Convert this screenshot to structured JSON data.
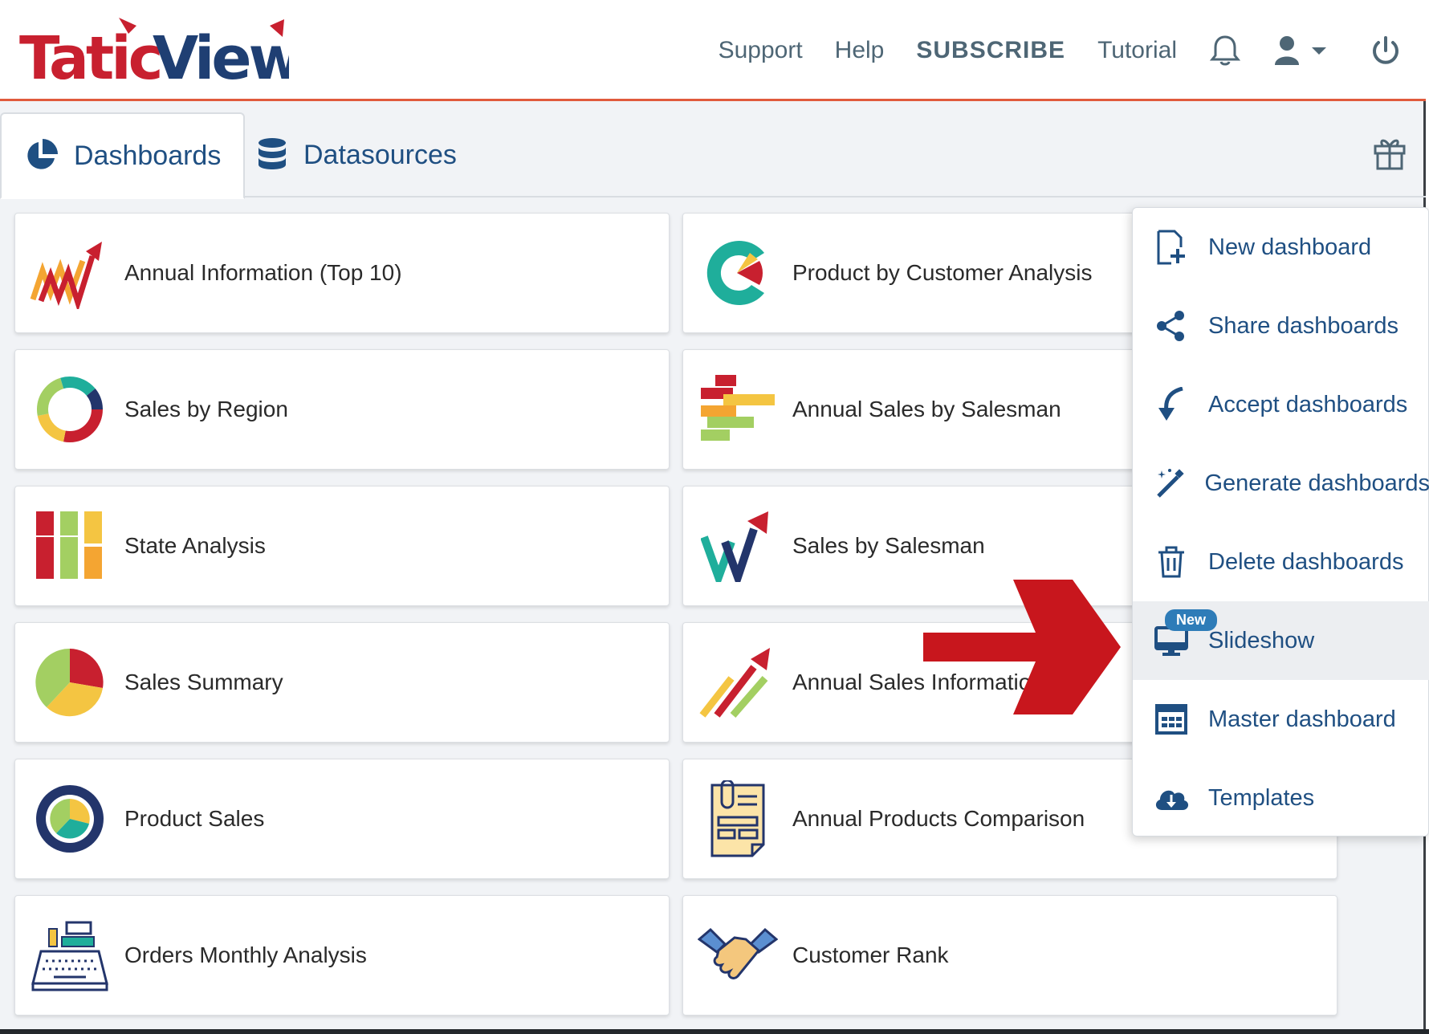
{
  "brand": {
    "logo_text": "TaticView",
    "accent": "#e05a3c",
    "primary": "#1f4f82"
  },
  "header": {
    "nav": [
      {
        "label": "Support"
      },
      {
        "label": "Help"
      },
      {
        "label": "SUBSCRIBE"
      },
      {
        "label": "Tutorial"
      }
    ],
    "icons": [
      "bell-icon",
      "user-icon",
      "chevron-down-icon",
      "power-icon"
    ]
  },
  "tabs": [
    {
      "label": "Dashboards",
      "icon": "pie-chart-icon",
      "active": true
    },
    {
      "label": "Datasources",
      "icon": "database-icon",
      "active": false
    }
  ],
  "dashboards": [
    {
      "label": "Annual Information (Top 10)",
      "icon": "trend-arrow-icon"
    },
    {
      "label": "Product by Customer Analysis",
      "icon": "c-pie-icon"
    },
    {
      "label": "Sales by Region",
      "icon": "donut-icon"
    },
    {
      "label": "Annual Sales by Salesman",
      "icon": "horizontal-bars-icon"
    },
    {
      "label": "State Analysis",
      "icon": "stacked-columns-icon"
    },
    {
      "label": "Sales by Salesman",
      "icon": "w-arrow-icon"
    },
    {
      "label": "Sales Summary",
      "icon": "pie-icon"
    },
    {
      "label": "Annual Sales Information",
      "icon": "rising-arrows-icon"
    },
    {
      "label": "Product Sales",
      "icon": "ring-pie-icon"
    },
    {
      "label": "Annual Products Comparison",
      "icon": "clipboard-document-icon"
    },
    {
      "label": "Orders Monthly Analysis",
      "icon": "cash-register-icon"
    },
    {
      "label": "Customer Rank",
      "icon": "handshake-icon"
    }
  ],
  "menu": {
    "items": [
      {
        "label": "New dashboard",
        "icon": "file-plus-icon"
      },
      {
        "label": "Share dashboards",
        "icon": "share-icon"
      },
      {
        "label": "Accept dashboards",
        "icon": "accept-arrow-icon"
      },
      {
        "label": "Generate dashboards",
        "icon": "magic-wand-icon"
      },
      {
        "label": "Delete dashboards",
        "icon": "trash-icon"
      },
      {
        "label": "Slideshow",
        "icon": "monitor-icon",
        "badge": "New",
        "highlighted": true
      },
      {
        "label": "Master dashboard",
        "icon": "layout-icon"
      },
      {
        "label": "Templates",
        "icon": "cloud-download-icon"
      }
    ]
  }
}
